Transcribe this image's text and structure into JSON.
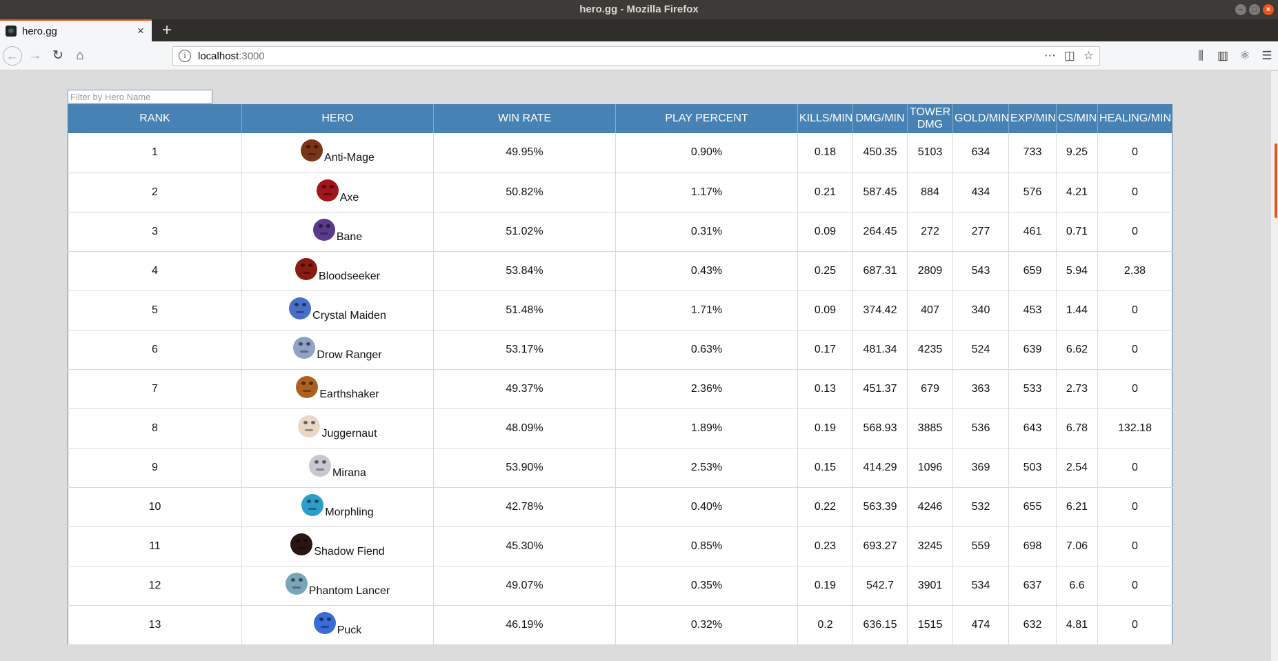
{
  "window": {
    "title": "hero.gg - Mozilla Firefox"
  },
  "tab": {
    "title": "hero.gg"
  },
  "url": {
    "host": "localhost",
    "port": ":3000"
  },
  "filter": {
    "placeholder": "Filter by Hero Name",
    "value": ""
  },
  "table": {
    "headers": {
      "rank": "RANK",
      "hero": "HERO",
      "win_rate": "WIN RATE",
      "play_percent": "PLAY PERCENT",
      "kills": "KILLS/MIN",
      "dmg": "DMG/MIN",
      "tower_dmg": "TOWER DMG",
      "gold": "GOLD/MIN",
      "exp": "EXP/MIN",
      "cs": "CS/MIN",
      "healing": "HEALING/MIN"
    },
    "rows": [
      {
        "rank": "1",
        "hero": "Anti-Mage",
        "win_rate": "49.95%",
        "play_percent": "0.90%",
        "kills": "0.18",
        "dmg": "450.35",
        "tower_dmg": "5103",
        "gold": "634",
        "exp": "733",
        "cs": "9.25",
        "healing": "0",
        "icon": "anti-mage-portrait-icon",
        "color": "#7a3416"
      },
      {
        "rank": "2",
        "hero": "Axe",
        "win_rate": "50.82%",
        "play_percent": "1.17%",
        "kills": "0.21",
        "dmg": "587.45",
        "tower_dmg": "884",
        "gold": "434",
        "exp": "576",
        "cs": "4.21",
        "healing": "0",
        "icon": "axe-portrait-icon",
        "color": "#a0161a"
      },
      {
        "rank": "3",
        "hero": "Bane",
        "win_rate": "51.02%",
        "play_percent": "0.31%",
        "kills": "0.09",
        "dmg": "264.45",
        "tower_dmg": "272",
        "gold": "277",
        "exp": "461",
        "cs": "0.71",
        "healing": "0",
        "icon": "bane-portrait-icon",
        "color": "#5b3a8c"
      },
      {
        "rank": "4",
        "hero": "Bloodseeker",
        "win_rate": "53.84%",
        "play_percent": "0.43%",
        "kills": "0.25",
        "dmg": "687.31",
        "tower_dmg": "2809",
        "gold": "543",
        "exp": "659",
        "cs": "5.94",
        "healing": "2.38",
        "icon": "bloodseeker-portrait-icon",
        "color": "#8b1a10"
      },
      {
        "rank": "5",
        "hero": "Crystal Maiden",
        "win_rate": "51.48%",
        "play_percent": "1.71%",
        "kills": "0.09",
        "dmg": "374.42",
        "tower_dmg": "407",
        "gold": "340",
        "exp": "453",
        "cs": "1.44",
        "healing": "0",
        "icon": "crystal-maiden-portrait-icon",
        "color": "#4a6fc9"
      },
      {
        "rank": "6",
        "hero": "Drow Ranger",
        "win_rate": "53.17%",
        "play_percent": "0.63%",
        "kills": "0.17",
        "dmg": "481.34",
        "tower_dmg": "4235",
        "gold": "524",
        "exp": "639",
        "cs": "6.62",
        "healing": "0",
        "icon": "drow-ranger-portrait-icon",
        "color": "#8fa4c4"
      },
      {
        "rank": "7",
        "hero": "Earthshaker",
        "win_rate": "49.37%",
        "play_percent": "2.36%",
        "kills": "0.13",
        "dmg": "451.37",
        "tower_dmg": "679",
        "gold": "363",
        "exp": "533",
        "cs": "2.73",
        "healing": "0",
        "icon": "earthshaker-portrait-icon",
        "color": "#b0601e"
      },
      {
        "rank": "8",
        "hero": "Juggernaut",
        "win_rate": "48.09%",
        "play_percent": "1.89%",
        "kills": "0.19",
        "dmg": "568.93",
        "tower_dmg": "3885",
        "gold": "536",
        "exp": "643",
        "cs": "6.78",
        "healing": "132.18",
        "icon": "juggernaut-portrait-icon",
        "color": "#e8d8c8"
      },
      {
        "rank": "9",
        "hero": "Mirana",
        "win_rate": "53.90%",
        "play_percent": "2.53%",
        "kills": "0.15",
        "dmg": "414.29",
        "tower_dmg": "1096",
        "gold": "369",
        "exp": "503",
        "cs": "2.54",
        "healing": "0",
        "icon": "mirana-portrait-icon",
        "color": "#c8c8d0"
      },
      {
        "rank": "10",
        "hero": "Morphling",
        "win_rate": "42.78%",
        "play_percent": "0.40%",
        "kills": "0.22",
        "dmg": "563.39",
        "tower_dmg": "4246",
        "gold": "532",
        "exp": "655",
        "cs": "6.21",
        "healing": "0",
        "icon": "morphling-portrait-icon",
        "color": "#2a9ec8"
      },
      {
        "rank": "11",
        "hero": "Shadow Fiend",
        "win_rate": "45.30%",
        "play_percent": "0.85%",
        "kills": "0.23",
        "dmg": "693.27",
        "tower_dmg": "3245",
        "gold": "559",
        "exp": "698",
        "cs": "7.06",
        "healing": "0",
        "icon": "shadow-fiend-portrait-icon",
        "color": "#2a1414"
      },
      {
        "rank": "12",
        "hero": "Phantom Lancer",
        "win_rate": "49.07%",
        "play_percent": "0.35%",
        "kills": "0.19",
        "dmg": "542.7",
        "tower_dmg": "3901",
        "gold": "534",
        "exp": "637",
        "cs": "6.6",
        "healing": "0",
        "icon": "phantom-lancer-portrait-icon",
        "color": "#7aa4b8"
      },
      {
        "rank": "13",
        "hero": "Puck",
        "win_rate": "46.19%",
        "play_percent": "0.32%",
        "kills": "0.2",
        "dmg": "636.15",
        "tower_dmg": "1515",
        "gold": "474",
        "exp": "632",
        "cs": "4.81",
        "healing": "0",
        "icon": "puck-portrait-icon",
        "color": "#3a6cd8"
      }
    ]
  }
}
